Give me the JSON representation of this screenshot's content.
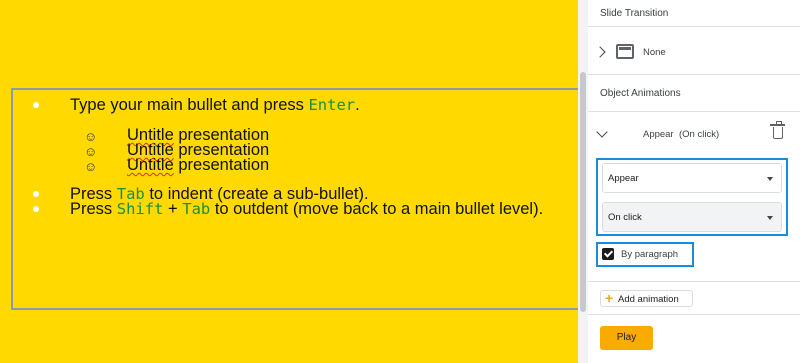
{
  "slide": {
    "bullets": [
      {
        "text_before": "Type your main bullet and press ",
        "code": "Enter",
        "text_after": "."
      },
      {
        "text_before": "Press ",
        "code": "Tab",
        "text_after": " to indent (create a sub-bullet)."
      },
      {
        "text_before": "Press ",
        "code": "Shift",
        "middle": " + ",
        "code2": "Tab",
        "text_after": " to outdent (move back to a main bullet level)."
      }
    ],
    "sub_bullets": [
      {
        "word": "Untitle",
        "rest": " presentation"
      },
      {
        "word": "Untitle",
        "rest": " presentation"
      },
      {
        "word": "Untitle",
        "rest": " presentation"
      }
    ],
    "sub_bullet_glyph": "☺"
  },
  "panel": {
    "slide_transition_title": "Slide Transition",
    "transition_value": "None",
    "object_animations_title": "Object Animations",
    "animation_name": "Appear",
    "animation_trigger": "(On click)",
    "effect_select": "Appear",
    "trigger_select": "On click",
    "by_paragraph_label": "By paragraph",
    "by_paragraph_checked": true,
    "add_animation_label": "Add animation",
    "add_icon": "+",
    "play_label": "Play"
  },
  "colors": {
    "slide_background": "#ffd900",
    "highlight_border": "#1a8cd8",
    "code_text": "#1e8e3e",
    "play_button": "#f9ab00"
  }
}
